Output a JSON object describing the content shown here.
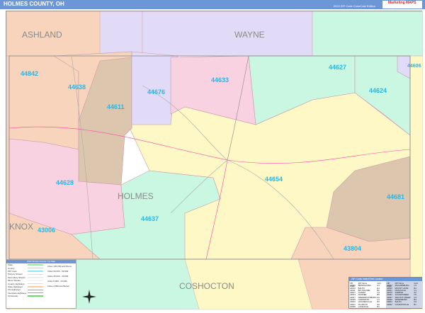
{
  "header": {
    "title": "HOLMES COUNTY, OH",
    "edition": "2022 ZIP Code ColorCast Edition",
    "logo": "Marketing MAPS"
  },
  "counties": [
    "ASHLAND",
    "WAYNE",
    "HOLMES",
    "KNOX",
    "COSHOCTON"
  ],
  "zips": [
    "44842",
    "44638",
    "44611",
    "44676",
    "44633",
    "44627",
    "44624",
    "44606",
    "44628",
    "44654",
    "44637",
    "43006",
    "44681",
    "43804"
  ],
  "colors": {
    "yellow": "#fdf8c6",
    "peach": "#f8d4bc",
    "purple": "#e2dbf7",
    "green": "#c9f7e2",
    "pink": "#f8d2e0",
    "tan": "#dcc7ae",
    "label": "#29b6e6",
    "header": "#6d96d6"
  },
  "legend": {
    "title": "2022 Simple Counts / Co Map",
    "items": [
      "State",
      "County",
      "ZIP Code",
      "Primary Streets",
      "Secondary Streets",
      "Minor Streets",
      "County Highways",
      "State Highways",
      "US Highways",
      "Interstate Highways",
      "Toll Roads"
    ],
    "sizes": [
      "Cities 100,000 and Above",
      "Cities 50,000 - 99,999",
      "Cities 25,000 - 49,999",
      "Cities 5,000 - 24,999",
      "Cities 4,999 and Below"
    ]
  },
  "index": {
    "title": "ZIP Code Index/Grid Locator",
    "header": [
      "ZIP Code",
      "ZIP Name",
      "Grid"
    ],
    "left": [
      [
        "43006",
        "BRINKHAVEN",
        "D1"
      ],
      [
        "44610",
        "BALTIC",
        "E4"
      ],
      [
        "44611",
        "BIG PRAIRIE",
        "B2"
      ],
      [
        "44617",
        "CHARM",
        "C4"
      ],
      [
        "44624",
        "DUNDEE",
        "B5"
      ],
      [
        "44627",
        "FREDERICKSBURG",
        "A4"
      ],
      [
        "44628",
        "GLENMONT",
        "C1"
      ],
      [
        "44633",
        "HOLMESVILLE",
        "B3"
      ],
      [
        "44637",
        "KILLBUCK",
        "D2"
      ],
      [
        "44638",
        "LAKEVILLE",
        "B1"
      ]
    ],
    "right": [
      [
        "44654",
        "MILLERSBURG",
        "C3"
      ],
      [
        "44660",
        "MOUNT HOPE",
        "B4"
      ],
      [
        "44661",
        "NASHVILLE",
        "C1"
      ],
      [
        "44676",
        "SHREVE",
        "A2"
      ],
      [
        "44681",
        "SUGARCREEK",
        "C5"
      ],
      [
        "44687",
        "WALNUT CREEK",
        "C4"
      ],
      [
        "44690",
        "WINESBURG",
        "B4"
      ],
      [
        "43804",
        "BALTIC",
        "D4"
      ],
      [
        "44842",
        "LOUDONVILLE",
        "B1"
      ]
    ]
  }
}
